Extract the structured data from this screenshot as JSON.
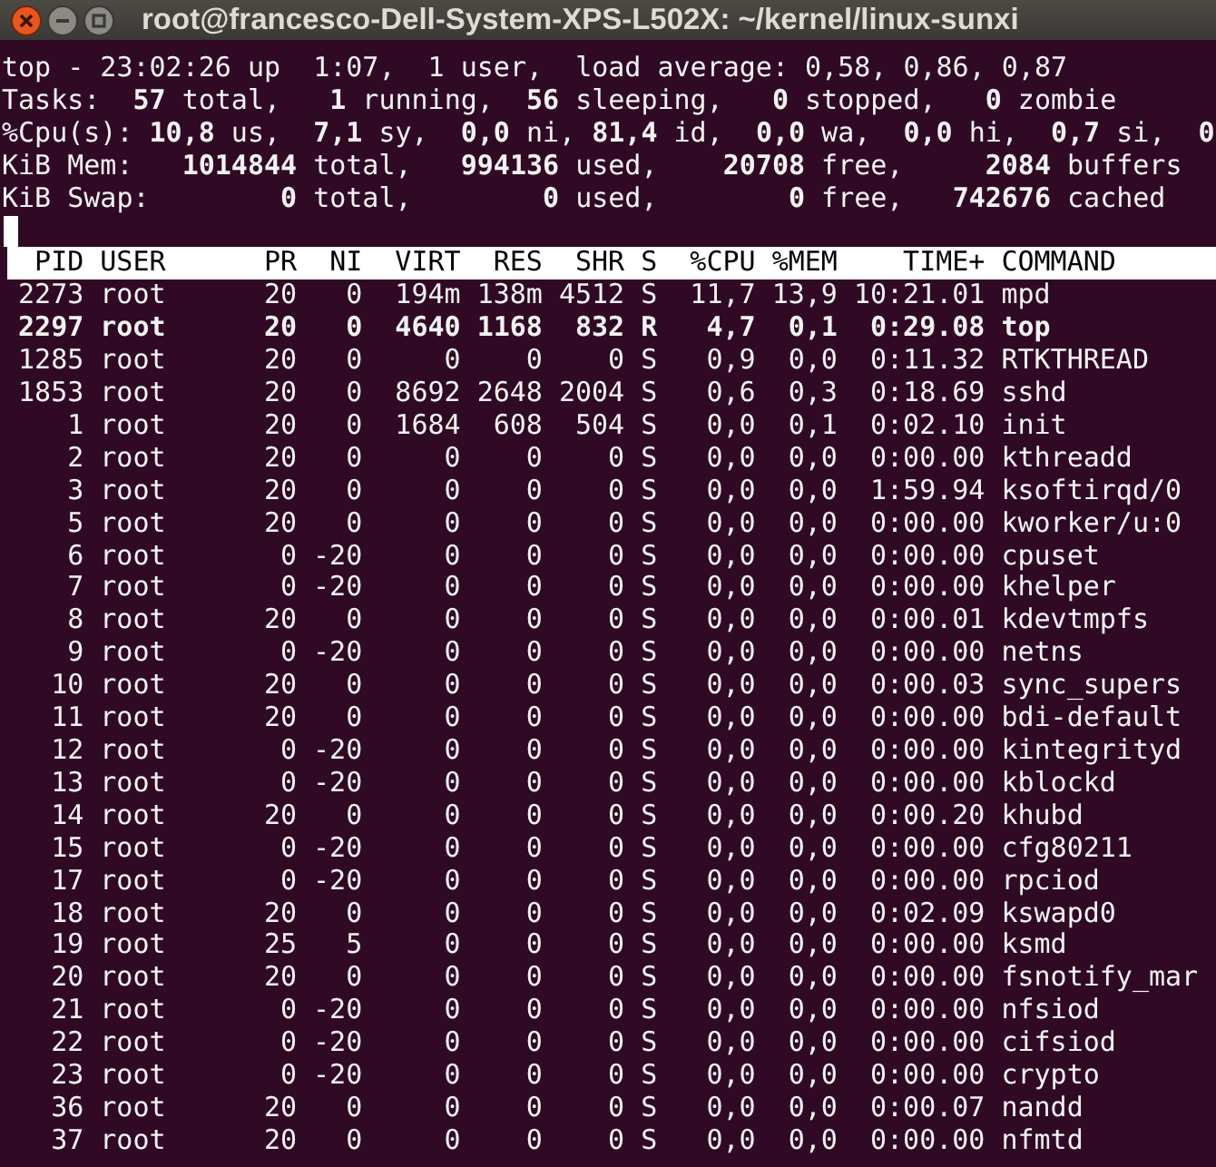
{
  "window": {
    "title": "root@francesco-Dell-System-XPS-L502X: ~/kernel/linux-sunxi"
  },
  "summary_lines": [
    "top - 23:02:26 up  1:07,  1 user,  load average: 0,58, 0,86, 0,87",
    "Tasks:  **57** total,   **1** running,  **56** sleeping,   **0** stopped,   **0** zombie",
    "%Cpu(s): **10,8** us,  **7,1** sy,  **0,0** ni, **81,4** id,  **0,0** wa,  **0,0** hi,  **0,7** si,  **0**",
    "KiB Mem:   **1014844** total,   **994136** used,    **20708** free,     **2084** buffers",
    "KiB Swap:        **0** total,        **0** used,        **0** free,   **742676** cached"
  ],
  "table": {
    "columns": [
      "PID",
      "USER",
      "PR",
      "NI",
      "VIRT",
      "RES",
      "SHR",
      "S",
      "%CPU",
      "%MEM",
      "TIME+",
      "COMMAND"
    ],
    "rows": [
      {
        "highlighted": false,
        "cells": [
          "2273",
          "root",
          "20",
          "0",
          "194m",
          "138m",
          "4512",
          "S",
          "11,7",
          "13,9",
          "10:21.01",
          "mpd"
        ]
      },
      {
        "highlighted": true,
        "cells": [
          "2297",
          "root",
          "20",
          "0",
          "4640",
          "1168",
          "832",
          "R",
          "4,7",
          "0,1",
          "0:29.08",
          "top"
        ]
      },
      {
        "highlighted": false,
        "cells": [
          "1285",
          "root",
          "20",
          "0",
          "0",
          "0",
          "0",
          "S",
          "0,9",
          "0,0",
          "0:11.32",
          "RTKTHREAD"
        ]
      },
      {
        "highlighted": false,
        "cells": [
          "1853",
          "root",
          "20",
          "0",
          "8692",
          "2648",
          "2004",
          "S",
          "0,6",
          "0,3",
          "0:18.69",
          "sshd"
        ]
      },
      {
        "highlighted": false,
        "cells": [
          "1",
          "root",
          "20",
          "0",
          "1684",
          "608",
          "504",
          "S",
          "0,0",
          "0,1",
          "0:02.10",
          "init"
        ]
      },
      {
        "highlighted": false,
        "cells": [
          "2",
          "root",
          "20",
          "0",
          "0",
          "0",
          "0",
          "S",
          "0,0",
          "0,0",
          "0:00.00",
          "kthreadd"
        ]
      },
      {
        "highlighted": false,
        "cells": [
          "3",
          "root",
          "20",
          "0",
          "0",
          "0",
          "0",
          "S",
          "0,0",
          "0,0",
          "1:59.94",
          "ksoftirqd/0"
        ]
      },
      {
        "highlighted": false,
        "cells": [
          "5",
          "root",
          "20",
          "0",
          "0",
          "0",
          "0",
          "S",
          "0,0",
          "0,0",
          "0:00.00",
          "kworker/u:0"
        ]
      },
      {
        "highlighted": false,
        "cells": [
          "6",
          "root",
          "0",
          "-20",
          "0",
          "0",
          "0",
          "S",
          "0,0",
          "0,0",
          "0:00.00",
          "cpuset"
        ]
      },
      {
        "highlighted": false,
        "cells": [
          "7",
          "root",
          "0",
          "-20",
          "0",
          "0",
          "0",
          "S",
          "0,0",
          "0,0",
          "0:00.00",
          "khelper"
        ]
      },
      {
        "highlighted": false,
        "cells": [
          "8",
          "root",
          "20",
          "0",
          "0",
          "0",
          "0",
          "S",
          "0,0",
          "0,0",
          "0:00.01",
          "kdevtmpfs"
        ]
      },
      {
        "highlighted": false,
        "cells": [
          "9",
          "root",
          "0",
          "-20",
          "0",
          "0",
          "0",
          "S",
          "0,0",
          "0,0",
          "0:00.00",
          "netns"
        ]
      },
      {
        "highlighted": false,
        "cells": [
          "10",
          "root",
          "20",
          "0",
          "0",
          "0",
          "0",
          "S",
          "0,0",
          "0,0",
          "0:00.03",
          "sync_supers"
        ]
      },
      {
        "highlighted": false,
        "cells": [
          "11",
          "root",
          "20",
          "0",
          "0",
          "0",
          "0",
          "S",
          "0,0",
          "0,0",
          "0:00.00",
          "bdi-default"
        ]
      },
      {
        "highlighted": false,
        "cells": [
          "12",
          "root",
          "0",
          "-20",
          "0",
          "0",
          "0",
          "S",
          "0,0",
          "0,0",
          "0:00.00",
          "kintegrityd"
        ]
      },
      {
        "highlighted": false,
        "cells": [
          "13",
          "root",
          "0",
          "-20",
          "0",
          "0",
          "0",
          "S",
          "0,0",
          "0,0",
          "0:00.00",
          "kblockd"
        ]
      },
      {
        "highlighted": false,
        "cells": [
          "14",
          "root",
          "20",
          "0",
          "0",
          "0",
          "0",
          "S",
          "0,0",
          "0,0",
          "0:00.20",
          "khubd"
        ]
      },
      {
        "highlighted": false,
        "cells": [
          "15",
          "root",
          "0",
          "-20",
          "0",
          "0",
          "0",
          "S",
          "0,0",
          "0,0",
          "0:00.00",
          "cfg80211"
        ]
      },
      {
        "highlighted": false,
        "cells": [
          "17",
          "root",
          "0",
          "-20",
          "0",
          "0",
          "0",
          "S",
          "0,0",
          "0,0",
          "0:00.00",
          "rpciod"
        ]
      },
      {
        "highlighted": false,
        "cells": [
          "18",
          "root",
          "20",
          "0",
          "0",
          "0",
          "0",
          "S",
          "0,0",
          "0,0",
          "0:02.09",
          "kswapd0"
        ]
      },
      {
        "highlighted": false,
        "cells": [
          "19",
          "root",
          "25",
          "5",
          "0",
          "0",
          "0",
          "S",
          "0,0",
          "0,0",
          "0:00.00",
          "ksmd"
        ]
      },
      {
        "highlighted": false,
        "cells": [
          "20",
          "root",
          "20",
          "0",
          "0",
          "0",
          "0",
          "S",
          "0,0",
          "0,0",
          "0:00.00",
          "fsnotify_mar"
        ]
      },
      {
        "highlighted": false,
        "cells": [
          "21",
          "root",
          "0",
          "-20",
          "0",
          "0",
          "0",
          "S",
          "0,0",
          "0,0",
          "0:00.00",
          "nfsiod"
        ]
      },
      {
        "highlighted": false,
        "cells": [
          "22",
          "root",
          "0",
          "-20",
          "0",
          "0",
          "0",
          "S",
          "0,0",
          "0,0",
          "0:00.00",
          "cifsiod"
        ]
      },
      {
        "highlighted": false,
        "cells": [
          "23",
          "root",
          "0",
          "-20",
          "0",
          "0",
          "0",
          "S",
          "0,0",
          "0,0",
          "0:00.00",
          "crypto"
        ]
      },
      {
        "highlighted": false,
        "cells": [
          "36",
          "root",
          "20",
          "0",
          "0",
          "0",
          "0",
          "S",
          "0,0",
          "0,0",
          "0:00.07",
          "nandd"
        ]
      },
      {
        "highlighted": false,
        "cells": [
          "37",
          "root",
          "20",
          "0",
          "0",
          "0",
          "0",
          "S",
          "0,0",
          "0,0",
          "0:00.00",
          "nfmtd"
        ]
      }
    ]
  }
}
